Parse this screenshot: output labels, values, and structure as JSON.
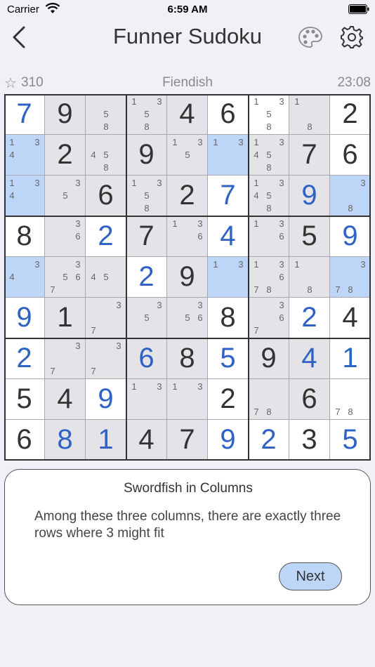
{
  "status": {
    "carrier": "Carrier",
    "time": "6:59 AM"
  },
  "header": {
    "title": "Funner Sudoku"
  },
  "info": {
    "star": "☆",
    "score": "310",
    "difficulty": "Fiendish",
    "timer": "23:08"
  },
  "hint": {
    "title": "Swordfish in Columns",
    "text": "Among these three columns, there are exactly three rows where 3 might fit",
    "next_label": "Next"
  },
  "colors": {
    "given": "#333333",
    "user": "#2e62c4",
    "highlight": "#bdd5f6",
    "shade": "#e3e3e8",
    "white": "#ffffff"
  },
  "grid": [
    [
      {
        "v": "7",
        "k": "user",
        "bg": "w"
      },
      {
        "v": "9",
        "k": "given",
        "bg": "g"
      },
      {
        "c": [
          5,
          8
        ],
        "bg": "g"
      },
      {
        "c": [
          1,
          3,
          5,
          8
        ],
        "bg": "g"
      },
      {
        "v": "4",
        "k": "given",
        "bg": "g"
      },
      {
        "v": "6",
        "k": "given",
        "bg": "w"
      },
      {
        "c": [
          1,
          3,
          5,
          8
        ],
        "bg": "w"
      },
      {
        "c": [
          1,
          8
        ],
        "bg": "g"
      },
      {
        "v": "2",
        "k": "given",
        "bg": "w"
      }
    ],
    [
      {
        "c": [
          1,
          3,
          4
        ],
        "bg": "b"
      },
      {
        "v": "2",
        "k": "given",
        "bg": "g"
      },
      {
        "c": [
          4,
          5,
          8
        ],
        "bg": "g"
      },
      {
        "v": "9",
        "k": "given",
        "bg": "g"
      },
      {
        "c": [
          1,
          3,
          5
        ],
        "bg": "g"
      },
      {
        "c": [
          1,
          3
        ],
        "bg": "b"
      },
      {
        "c": [
          1,
          3,
          4,
          5,
          8
        ],
        "bg": "g"
      },
      {
        "v": "7",
        "k": "given",
        "bg": "g"
      },
      {
        "v": "6",
        "k": "given",
        "bg": "w"
      }
    ],
    [
      {
        "c": [
          1,
          3,
          4
        ],
        "bg": "b"
      },
      {
        "c": [
          3,
          5
        ],
        "bg": "g"
      },
      {
        "v": "6",
        "k": "given",
        "bg": "g"
      },
      {
        "c": [
          1,
          3,
          5,
          8
        ],
        "bg": "g"
      },
      {
        "v": "2",
        "k": "given",
        "bg": "g"
      },
      {
        "v": "7",
        "k": "user",
        "bg": "w"
      },
      {
        "c": [
          1,
          3,
          4,
          5,
          8
        ],
        "bg": "g"
      },
      {
        "v": "9",
        "k": "user",
        "bg": "g"
      },
      {
        "c": [
          3,
          8
        ],
        "bg": "b"
      }
    ],
    [
      {
        "v": "8",
        "k": "given",
        "bg": "w"
      },
      {
        "c": [
          3,
          6
        ],
        "bg": "g"
      },
      {
        "v": "2",
        "k": "user",
        "bg": "w"
      },
      {
        "v": "7",
        "k": "given",
        "bg": "g"
      },
      {
        "c": [
          1,
          3,
          6
        ],
        "bg": "g"
      },
      {
        "v": "4",
        "k": "user",
        "bg": "w"
      },
      {
        "c": [
          1,
          3,
          6
        ],
        "bg": "g"
      },
      {
        "v": "5",
        "k": "given",
        "bg": "g"
      },
      {
        "v": "9",
        "k": "user",
        "bg": "w"
      }
    ],
    [
      {
        "c": [
          3,
          4
        ],
        "bg": "b"
      },
      {
        "c": [
          3,
          5,
          6,
          7
        ],
        "bg": "g"
      },
      {
        "c": [
          4,
          5
        ],
        "bg": "g"
      },
      {
        "v": "2",
        "k": "user",
        "bg": "w"
      },
      {
        "v": "9",
        "k": "given",
        "bg": "g"
      },
      {
        "c": [
          1,
          3
        ],
        "bg": "b"
      },
      {
        "c": [
          1,
          3,
          6,
          7,
          8
        ],
        "bg": "g"
      },
      {
        "c": [
          1,
          8
        ],
        "bg": "g"
      },
      {
        "c": [
          3,
          7,
          8
        ],
        "bg": "b"
      }
    ],
    [
      {
        "v": "9",
        "k": "user",
        "bg": "w"
      },
      {
        "v": "1",
        "k": "given",
        "bg": "g"
      },
      {
        "c": [
          3,
          7
        ],
        "bg": "g"
      },
      {
        "c": [
          3,
          5
        ],
        "bg": "g"
      },
      {
        "c": [
          3,
          5,
          6
        ],
        "bg": "g"
      },
      {
        "v": "8",
        "k": "given",
        "bg": "w"
      },
      {
        "c": [
          3,
          6,
          7
        ],
        "bg": "g"
      },
      {
        "v": "2",
        "k": "user",
        "bg": "w"
      },
      {
        "v": "4",
        "k": "given",
        "bg": "w"
      }
    ],
    [
      {
        "v": "2",
        "k": "user",
        "bg": "w"
      },
      {
        "c": [
          3,
          7
        ],
        "bg": "g"
      },
      {
        "c": [
          3,
          7
        ],
        "bg": "g"
      },
      {
        "v": "6",
        "k": "user",
        "bg": "g"
      },
      {
        "v": "8",
        "k": "given",
        "bg": "g"
      },
      {
        "v": "5",
        "k": "user",
        "bg": "w"
      },
      {
        "v": "9",
        "k": "given",
        "bg": "g"
      },
      {
        "v": "4",
        "k": "user",
        "bg": "g"
      },
      {
        "v": "1",
        "k": "user",
        "bg": "w"
      }
    ],
    [
      {
        "v": "5",
        "k": "given",
        "bg": "w"
      },
      {
        "v": "4",
        "k": "given",
        "bg": "g"
      },
      {
        "v": "9",
        "k": "user",
        "bg": "w"
      },
      {
        "c": [
          1,
          3
        ],
        "bg": "g"
      },
      {
        "c": [
          1,
          3
        ],
        "bg": "g"
      },
      {
        "v": "2",
        "k": "given",
        "bg": "w"
      },
      {
        "c": [
          7,
          8
        ],
        "bg": "g"
      },
      {
        "v": "6",
        "k": "given",
        "bg": "g"
      },
      {
        "c": [
          7,
          8
        ],
        "bg": "w"
      }
    ],
    [
      {
        "v": "6",
        "k": "given",
        "bg": "w"
      },
      {
        "v": "8",
        "k": "user",
        "bg": "g"
      },
      {
        "v": "1",
        "k": "user",
        "bg": "g"
      },
      {
        "v": "4",
        "k": "given",
        "bg": "g"
      },
      {
        "v": "7",
        "k": "given",
        "bg": "g"
      },
      {
        "v": "9",
        "k": "user",
        "bg": "w"
      },
      {
        "v": "2",
        "k": "user",
        "bg": "w"
      },
      {
        "v": "3",
        "k": "given",
        "bg": "w"
      },
      {
        "v": "5",
        "k": "user",
        "bg": "w"
      }
    ]
  ]
}
